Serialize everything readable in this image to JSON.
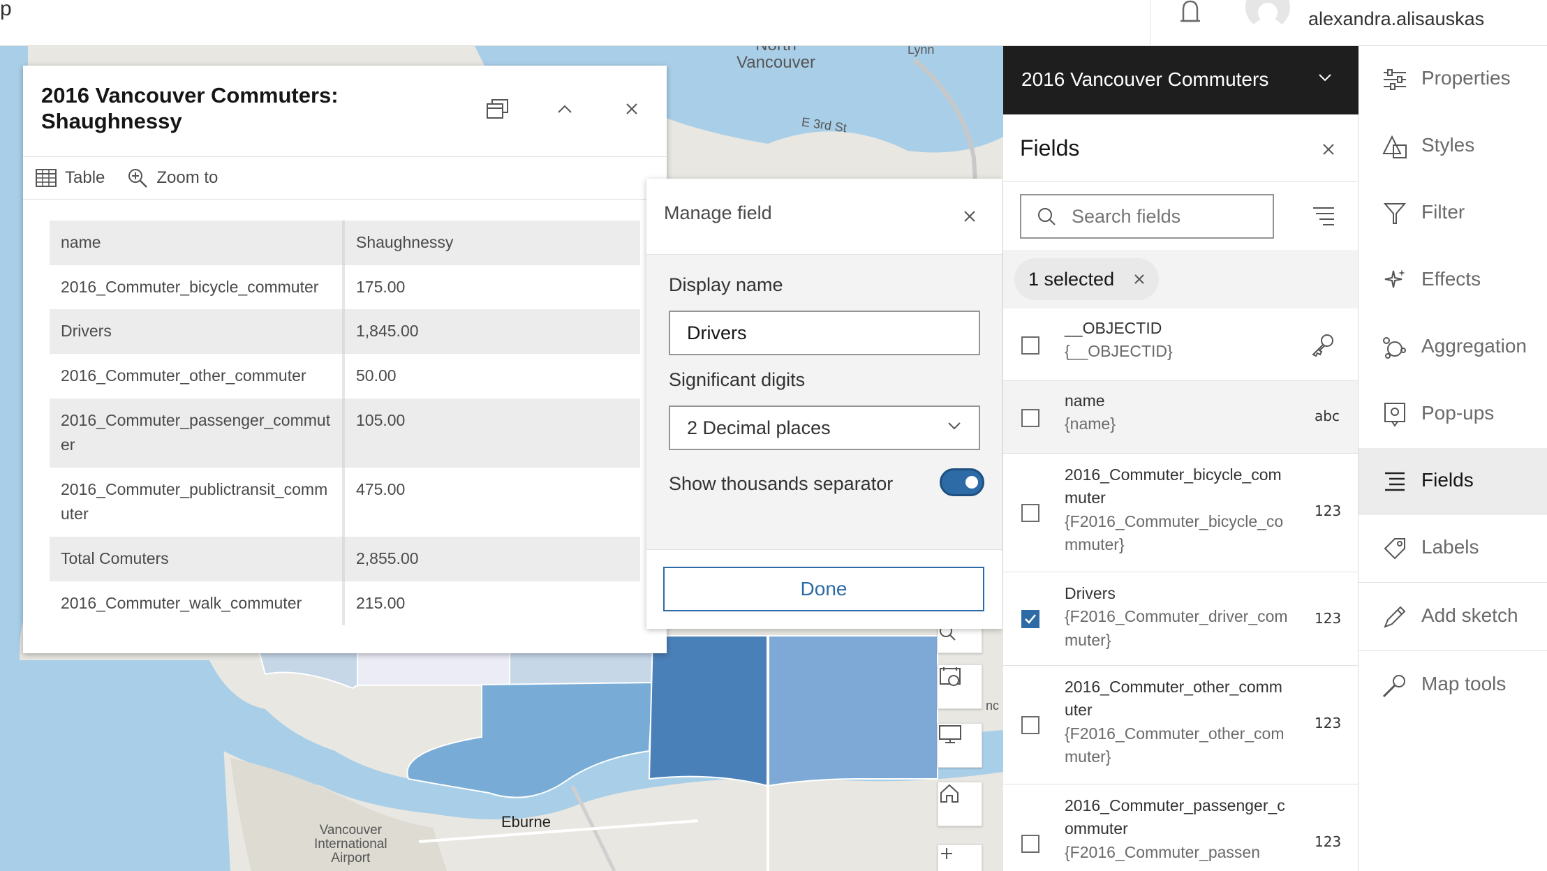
{
  "topbar": {
    "left_char": "p",
    "username": "alexandra.alisauskas"
  },
  "map": {
    "labels": {
      "north_vancouver": "North\nVancouver",
      "lynn": "Lynn",
      "e3rd": "E 3rd St",
      "eburne": "Eburne",
      "airport": "Vancouver\nInternational\nAirport",
      "partial": "nc"
    },
    "colors": {
      "water": "#a9cfe8",
      "land": "#e9e7e1",
      "choro_dark": "#4a80b8",
      "choro_mid": "#78acd6",
      "choro_midlight": "#7ea9d6",
      "choro_light": "#c6d7e8",
      "choro_pale": "#ececf7"
    }
  },
  "popup": {
    "title": "2016 Vancouver Commuters: Shaughnessy",
    "actions": [
      {
        "label": "Table",
        "icon": "table-icon"
      },
      {
        "label": "Zoom to",
        "icon": "zoom-to-icon"
      }
    ],
    "rows": [
      {
        "key": "name",
        "value": "Shaughnessy"
      },
      {
        "key": "2016_Commuter_bicycle_commuter",
        "value": "175.00"
      },
      {
        "key": "Drivers",
        "value": "1,845.00"
      },
      {
        "key": "2016_Commuter_other_commuter",
        "value": "50.00"
      },
      {
        "key": "2016_Commuter_passenger_commuter",
        "value": "105.00"
      },
      {
        "key": "2016_Commuter_publictransit_commuter",
        "value": "475.00"
      },
      {
        "key": "Total Comuters",
        "value": "2,855.00"
      },
      {
        "key": "2016_Commuter_walk_commuter",
        "value": "215.00"
      }
    ]
  },
  "manage_field": {
    "title": "Manage field",
    "display_name_label": "Display name",
    "display_name_value": "Drivers",
    "significant_digits_label": "Significant digits",
    "significant_digits_value": "2 Decimal places",
    "thousands_label": "Show thousands separator",
    "thousands_on": true,
    "done_label": "Done"
  },
  "layer": {
    "title": "2016 Vancouver Commuters"
  },
  "fields_panel": {
    "title": "Fields",
    "search_placeholder": "Search fields",
    "selected_label": "1 selected",
    "fields": [
      {
        "name": "__OBJECTID",
        "sub": "{__OBJECTID}",
        "type": "key",
        "checked": false
      },
      {
        "name": "name",
        "sub": "{name}",
        "type": "abc",
        "checked": false
      },
      {
        "name": "2016_Commuter_bicycle_commuter",
        "sub": "{F2016_Commuter_bicycle_commuter}",
        "type": "123",
        "checked": false
      },
      {
        "name": "Drivers",
        "sub": "{F2016_Commuter_driver_commuter}",
        "type": "123",
        "checked": true
      },
      {
        "name": "2016_Commuter_other_commuter",
        "sub": "{F2016_Commuter_other_commuter}",
        "type": "123",
        "checked": false
      },
      {
        "name": "2016_Commuter_passenger_commuter",
        "sub": "{F2016_Commuter_passen",
        "type": "123",
        "checked": false
      }
    ]
  },
  "right_nav": {
    "items": [
      {
        "label": "Properties",
        "icon": "properties-icon"
      },
      {
        "label": "Styles",
        "icon": "styles-icon"
      },
      {
        "label": "Filter",
        "icon": "filter-icon"
      },
      {
        "label": "Effects",
        "icon": "effects-icon"
      },
      {
        "label": "Aggregation",
        "icon": "aggregation-icon"
      },
      {
        "label": "Pop-ups",
        "icon": "popups-icon"
      },
      {
        "label": "Fields",
        "icon": "fields-icon",
        "active": true
      },
      {
        "label": "Labels",
        "icon": "labels-icon"
      },
      {
        "label": "Add sketch",
        "icon": "add-sketch-icon"
      },
      {
        "label": "Map tools",
        "icon": "map-tools-icon"
      }
    ]
  }
}
